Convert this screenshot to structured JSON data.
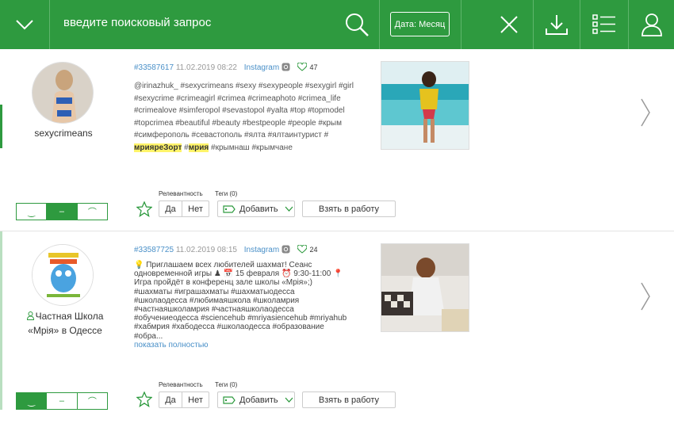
{
  "toolbar": {
    "search_placeholder": "введите поисковый запрос",
    "date_filter": "Дата: Месяц"
  },
  "posts": [
    {
      "id": "#33587617",
      "date": "11.02.2019 08:22",
      "source": "Instagram",
      "likes": "47",
      "author": "sexycrimeans",
      "text_lines": [
        "@irinazhuk_ #sexycrimeans #sexy #sexypeople #sexygirl #girl",
        "#sexycrime #crimeagirl #crimea #crimeaphoto #crimea_life",
        "#crimealove #simferopol #sevastopol #yalta #top #topmodel",
        "#topcrimea #beautiful #beauty #bestpeople #people #крым",
        "#симферополь #севастополь #ялта #ялтаинтурист #"
      ],
      "last_line": {
        "hl1": "мрияреЗорт",
        "mid": " #",
        "hl2": "мрия",
        "rest": " #крымнаш #крымчане"
      },
      "sentiment_selected": 1
    },
    {
      "id": "#33587725",
      "date": "11.02.2019 08:15",
      "source": "Instagram",
      "likes": "24",
      "author_line1": "Частная Школа",
      "author_line2": "«Мрія» в Одессе",
      "text_lines": [
        "💡 Приглашаем всех любителей шахмат! Сеанс",
        "одновременной игры ♟ 📅 15 февраля ⏰ 9:30-11:00 📍",
        "Игра пройдёт в конференц зале школы «Мрія»;)",
        "#шахматы #играшахматы #шахматыодесса",
        "#школаодесса #любимаяшкола #школамрия",
        "#частнаяшколамрия #частнаяшколаодесса",
        "#обучениеодесса #sciencehub #mriyasiencehub #mriyahub",
        "#хабмрия #хабодесса #школаодесса #образование",
        "#обра..."
      ],
      "show_more": "показать полностью",
      "sentiment_selected": 0
    }
  ],
  "controls": {
    "relevance_label": "Релевантность",
    "tags_label": "Теги (0)",
    "yes": "Да",
    "no": "Нет",
    "add": "Добавить",
    "take_to_work": "Взять в работу"
  },
  "colors": {
    "accent": "#2e9a3f",
    "link": "#4a90c8",
    "highlight": "#fff46a"
  }
}
